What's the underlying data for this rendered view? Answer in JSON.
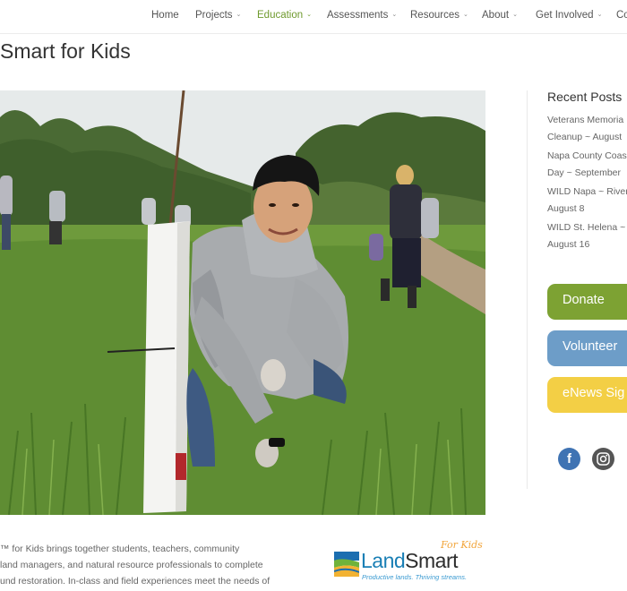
{
  "nav": {
    "items": [
      {
        "label": "Home",
        "caret": false,
        "active": false
      },
      {
        "label": "Projects",
        "caret": true,
        "active": false
      },
      {
        "label": "Education",
        "caret": true,
        "active": true
      },
      {
        "label": "Assessments",
        "caret": true,
        "active": false
      },
      {
        "label": "Resources",
        "caret": true,
        "active": false
      },
      {
        "label": "About",
        "caret": true,
        "active": false
      },
      {
        "label": "Get Involved",
        "caret": true,
        "active": false
      },
      {
        "label": "Co",
        "caret": false,
        "active": false
      }
    ],
    "caret_char": "⌄",
    "active_color": "#6f9a2e"
  },
  "page": {
    "title": "Smart for Kids"
  },
  "intro": {
    "lines": [
      "™ for Kids brings together students, teachers, community",
      " land managers, and natural resource professionals to complete",
      "und restoration. In-class and field experiences meet the needs of"
    ]
  },
  "logo": {
    "land": "Land",
    "smart": "Smart",
    "kids": "For Kids",
    "tagline": "Productive lands. Thriving streams."
  },
  "sidebar": {
    "recent_title": "Recent Posts",
    "posts": [
      {
        "line1": "Veterans Memoria",
        "line2": "Cleanup ~ August"
      },
      {
        "line1": "Napa County Coas",
        "line2": "Day ~ September"
      },
      {
        "line1": "WILD Napa ~ River",
        "line2": "August 8"
      },
      {
        "line1": "WILD St. Helena ~",
        "line2": "August 16"
      }
    ],
    "buttons": [
      {
        "label": "Donate",
        "color": "#7da233"
      },
      {
        "label": "Volunteer",
        "color": "#6d9dc8"
      },
      {
        "label": "eNews Sig",
        "color": "#f3cf45"
      }
    ],
    "social": [
      {
        "icon": "facebook-icon",
        "glyph": "f",
        "color": "#3f73b3"
      },
      {
        "icon": "instagram-icon",
        "color": "#555555"
      }
    ]
  }
}
